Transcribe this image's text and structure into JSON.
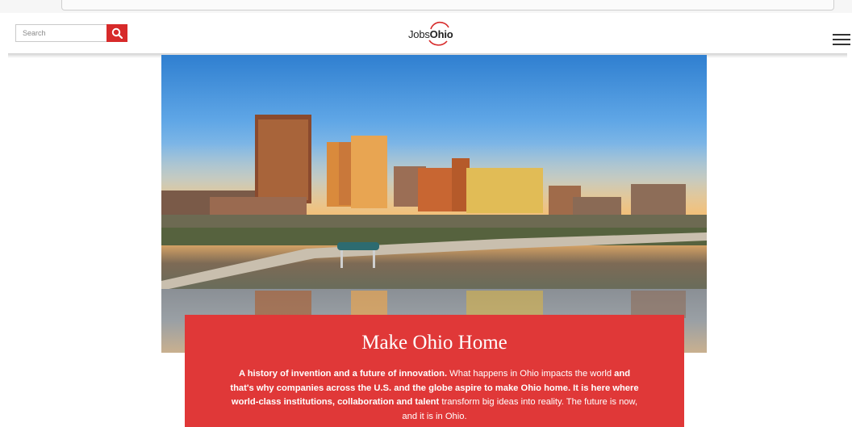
{
  "search": {
    "placeholder": "Search"
  },
  "logo": {
    "prefix": "Jobs",
    "suffix": "Ohio"
  },
  "hero": {
    "image_alt": "Ohio city skyline at sunset reflected in river"
  },
  "card": {
    "title": "Make Ohio Home",
    "body": [
      {
        "text": "A history of invention and a future of innovation.",
        "bold": true
      },
      {
        "text": " What happens in Ohio impacts the world ",
        "bold": false
      },
      {
        "text": "and that's why companies across the U.S. and the globe aspire to make Ohio home. It is here where world-class institutions, collaboration and talent",
        "bold": true
      },
      {
        "text": " transform big ideas into reality. The future is now, and it is in Ohio.",
        "bold": false
      }
    ]
  },
  "colors": {
    "accent": "#e03838",
    "search_button": "#d72a2a"
  },
  "icons": {
    "search": "search-icon",
    "menu": "hamburger-menu-icon",
    "logo": "jobsohio-logo"
  }
}
